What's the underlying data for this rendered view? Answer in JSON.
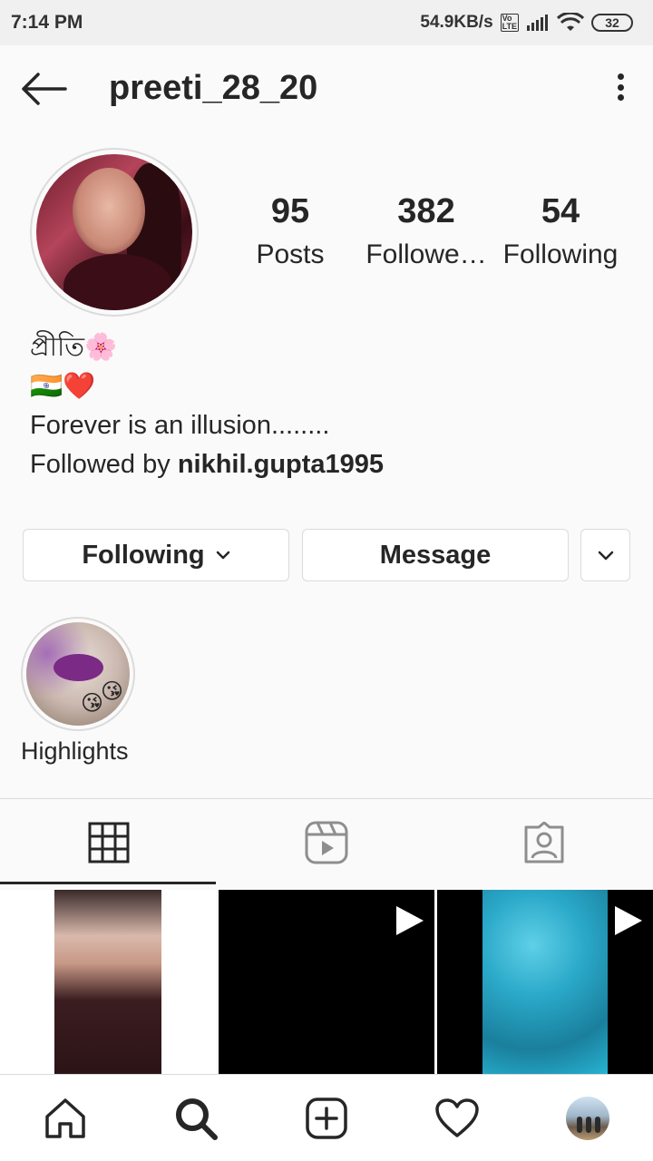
{
  "status_bar": {
    "time": "7:14 PM",
    "network_speed": "54.9KB/s",
    "volte_label": "Vo LTE",
    "battery": "32"
  },
  "header": {
    "username": "preeti_28_20"
  },
  "profile": {
    "stats": [
      {
        "value": "95",
        "label": "Posts"
      },
      {
        "value": "382",
        "label": "Followe…"
      },
      {
        "value": "54",
        "label": "Following"
      }
    ],
    "bio_name": "প্রীতি🌸",
    "bio_emojis": "🇮🇳❤️",
    "bio_text": "Forever is an illusion........",
    "followed_by_prefix": "Followed by ",
    "followed_by_user": "nikhil.gupta1995"
  },
  "actions": {
    "following_label": "Following",
    "message_label": "Message"
  },
  "highlights": [
    {
      "label": "Highlights"
    }
  ],
  "tabs": [
    {
      "icon": "grid-icon",
      "active": true
    },
    {
      "icon": "reels-icon",
      "active": false
    },
    {
      "icon": "tagged-icon",
      "active": false
    }
  ],
  "bottom_nav": [
    "home-icon",
    "search-icon",
    "new-post-icon",
    "activity-icon",
    "profile-avatar"
  ]
}
